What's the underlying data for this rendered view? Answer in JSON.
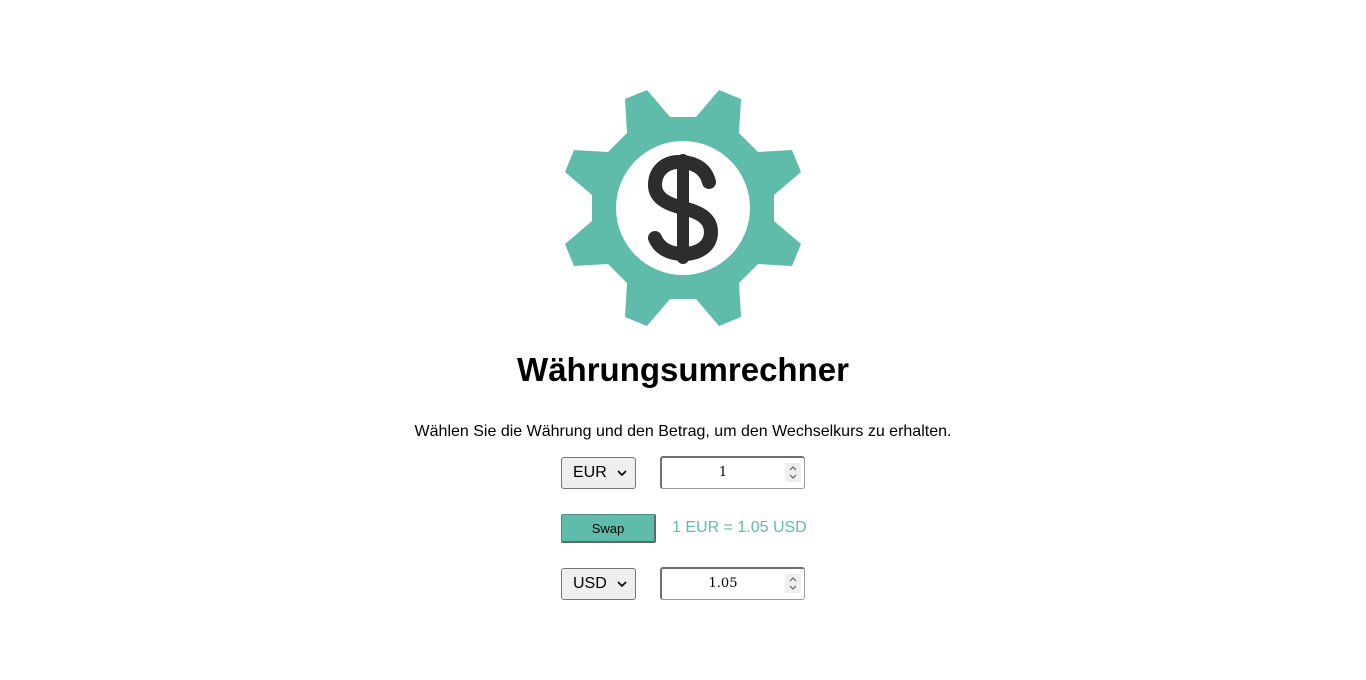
{
  "logo": {
    "icon": "dollar-gear-icon",
    "gear_color": "#5fbcaa",
    "symbol_color": "#2d2d2d"
  },
  "title": "Währungsumrechner",
  "subtitle": "Wählen Sie die Währung und den Betrag, um den Wechselkurs zu erhalten.",
  "converter": {
    "from": {
      "currency": "EUR",
      "amount": "1"
    },
    "to": {
      "currency": "USD",
      "amount": "1.05"
    },
    "swap_label": "Swap",
    "rate_text": "1 EUR = 1.05 USD"
  },
  "colors": {
    "accent": "#5fbcaa"
  }
}
